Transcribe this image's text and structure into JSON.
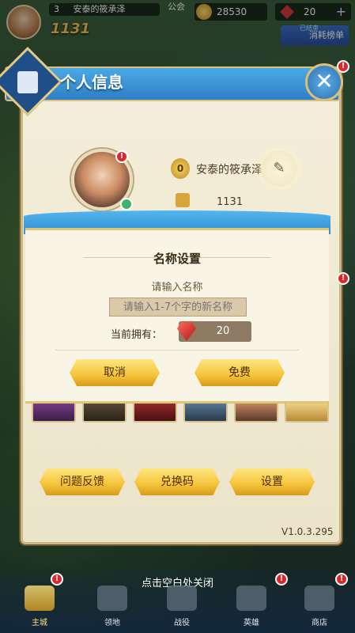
{
  "topbar": {
    "level": "3",
    "player_name": "安泰的筱承泽",
    "power": "1131",
    "guild_label": "公会",
    "gold": "28530",
    "gems": "20",
    "event_tag": "已结束",
    "event_label": "消耗榜单"
  },
  "panel": {
    "title": "个人信息",
    "close_label": "✕",
    "rank": "0",
    "player_name": "安泰的筱承泽",
    "power": "1131",
    "buttons": {
      "feedback": "问题反馈",
      "redeem": "兑换码",
      "settings": "设置"
    },
    "version": "V1.0.3.295"
  },
  "rename_dialog": {
    "title": "名称设置",
    "hint": "请输入名称",
    "input_placeholder": "请输入1-7个字的新名称",
    "owned_label": "当前拥有：",
    "owned_value": "20",
    "cancel_label": "取消",
    "free_label": "免费"
  },
  "close_tip": "点击空白处关闭",
  "nav": [
    {
      "label": "主城"
    },
    {
      "label": "领地"
    },
    {
      "label": "战役"
    },
    {
      "label": "英雄"
    },
    {
      "label": "商店"
    }
  ],
  "colors": {
    "header_blue": "#2f7ec5",
    "gold_button": "#f5c33a",
    "panel_bg": "#f4eedb",
    "alert_red": "#e0262b"
  }
}
